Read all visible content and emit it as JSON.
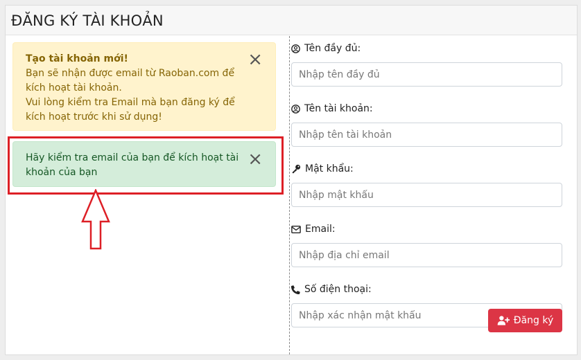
{
  "header": {
    "title": "ĐĂNG KÝ TÀI KHOẢN"
  },
  "alerts": {
    "warning": {
      "title": "Tạo tài khoản mới!",
      "line1": "Bạn sẽ nhận được email từ Raoban.com để kích hoạt tài khoản.",
      "line2": "Vui lòng kiểm tra Email mà bạn đăng ký để kích hoạt trước khi sử dụng!",
      "close": "×"
    },
    "success": {
      "text": "Hãy kiểm tra email của bạn để kích hoạt tài khoản của bạn",
      "close": "×"
    }
  },
  "form": {
    "fullname": {
      "label": "Tên đầy đủ:",
      "placeholder": "Nhập tên đầy đủ",
      "icon": "user-circle-icon"
    },
    "username": {
      "label": "Tên tài khoản:",
      "placeholder": "Nhập tên tài khoản",
      "icon": "user-circle-icon"
    },
    "password": {
      "label": "Mật khẩu:",
      "placeholder": "Nhập mật khẩu",
      "icon": "key-icon"
    },
    "email": {
      "label": "Email:",
      "placeholder": "Nhập địa chỉ email",
      "icon": "envelope-icon"
    },
    "phone": {
      "label": "Số điện thoại:",
      "placeholder": "Nhập xác nhận mật khẩu",
      "icon": "phone-icon"
    },
    "submit": {
      "label": "Đăng ký",
      "icon": "user-plus-icon"
    }
  },
  "annotation": {
    "highlight_color": "#dd1f26"
  }
}
